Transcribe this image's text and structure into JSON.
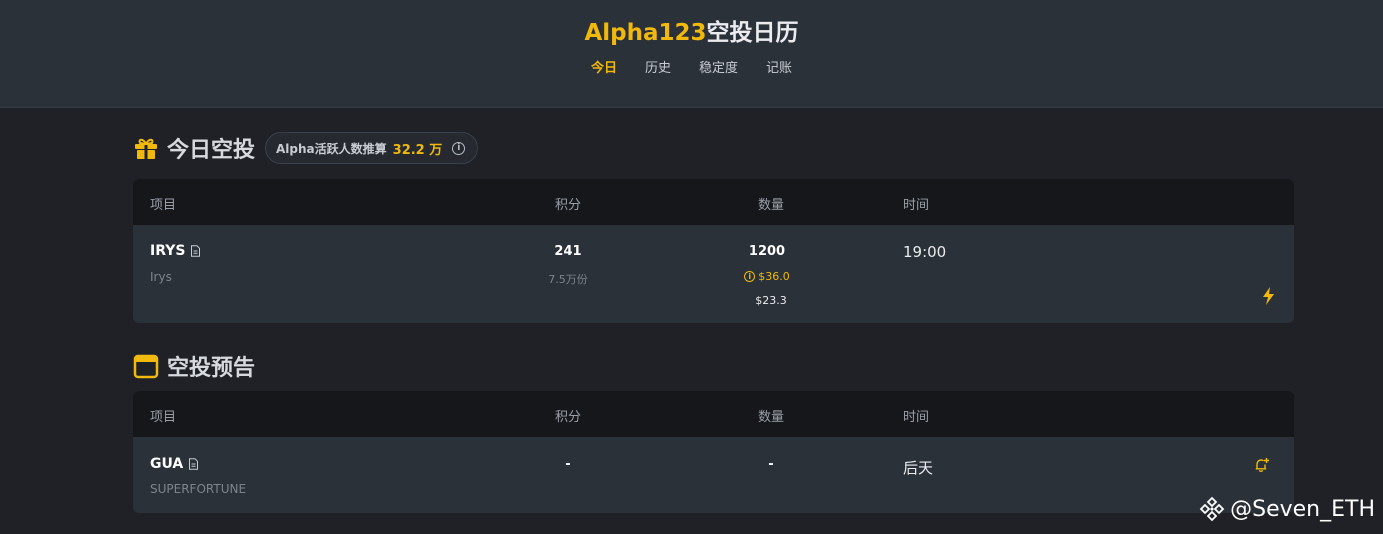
{
  "header": {
    "title_accent": "Alpha123",
    "title_rest": "空投日历",
    "nav": [
      {
        "label": "今日",
        "active": true
      },
      {
        "label": "历史",
        "active": false
      },
      {
        "label": "稳定度",
        "active": false
      },
      {
        "label": "记账",
        "active": false
      }
    ]
  },
  "today": {
    "title": "今日空投",
    "icon": "gift-icon",
    "active_users": {
      "label": "Alpha活跃人数推算",
      "value": "32.2 万",
      "icon": "info-icon"
    },
    "columns": [
      "项目",
      "积分",
      "数量",
      "时间"
    ],
    "rows": [
      {
        "symbol": "IRYS",
        "name": "Irys",
        "points": "241",
        "points_sub": "7.5万份",
        "quantity": "1200",
        "value_warn": "$36.0",
        "value_usd": "$23.3",
        "time": "19:00",
        "action_icon": "lightning-icon"
      }
    ]
  },
  "preview": {
    "title": "空投预告",
    "icon": "calendar-icon",
    "columns": [
      "项目",
      "积分",
      "数量",
      "时间"
    ],
    "rows": [
      {
        "symbol": "GUA",
        "name": "SUPERFORTUNE",
        "points": "-",
        "quantity": "-",
        "time": "后天",
        "action_icon": "bell-plus-icon"
      }
    ]
  },
  "watermark": {
    "text": "@Seven_ETH",
    "icon": "binance-logo-icon"
  },
  "colors": {
    "accent": "#f0b90b",
    "bg": "#1f2126",
    "panel": "#2b3139",
    "table_head": "#15171b"
  }
}
